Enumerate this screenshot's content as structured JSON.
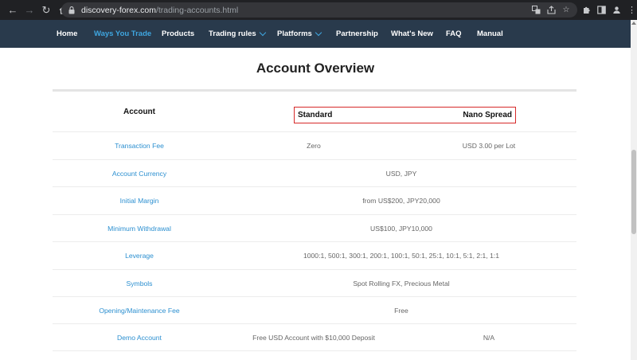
{
  "browser": {
    "url_host": "discovery-forex.com",
    "url_path": "/trading-accounts.html"
  },
  "nav": {
    "items": [
      {
        "label": "Home"
      },
      {
        "label": "Ways You Trade"
      },
      {
        "label": "Products"
      },
      {
        "label": "Trading rules"
      },
      {
        "label": "Platforms"
      },
      {
        "label": "Partnership"
      },
      {
        "label": "What's New"
      },
      {
        "label": "FAQ"
      },
      {
        "label": "Manual"
      }
    ],
    "accent_color": "#3fa6e0",
    "bar_color": "#293a4c"
  },
  "page": {
    "title": "Account Overview"
  },
  "table": {
    "headers": {
      "account": "Account",
      "standard": "Standard",
      "nano": "Nano Spread"
    },
    "highlight_color": "#d62a2a",
    "rows": [
      {
        "label": "Transaction Fee",
        "standard": "Zero",
        "nano": "USD 3.00 per Lot"
      },
      {
        "label": "Account Currency",
        "both": "USD, JPY"
      },
      {
        "label": "Initial Margin",
        "both": "from US$200, JPY20,000"
      },
      {
        "label": "Minimum Withdrawal",
        "both": "US$100, JPY10,000"
      },
      {
        "label": "Leverage",
        "both": "1000:1, 500:1, 300:1, 200:1, 100:1, 50:1, 25:1, 10:1, 5:1, 2:1, 1:1"
      },
      {
        "label": "Symbols",
        "both": "Spot Rolling FX, Precious Metal"
      },
      {
        "label": "Opening/Maintenance Fee",
        "both": "Free"
      },
      {
        "label": "Demo Account",
        "standard": "Free USD Account with $10,000 Deposit",
        "nano": "N/A"
      }
    ]
  }
}
